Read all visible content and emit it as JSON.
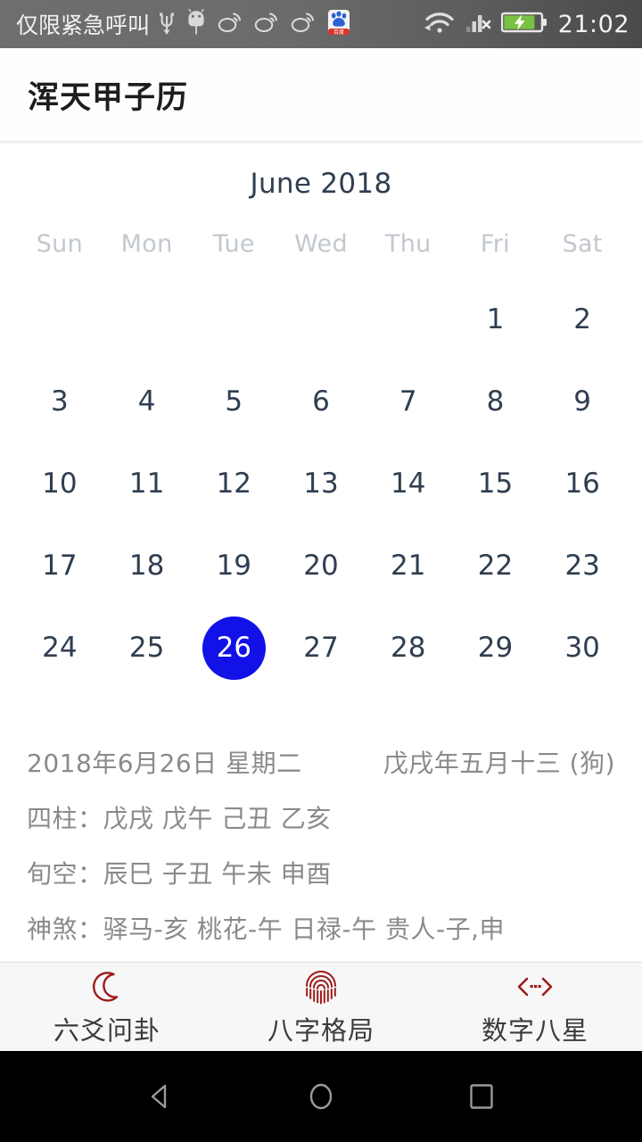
{
  "statusbar": {
    "carrier_text": "仅限紧急呼叫",
    "clock": "21:02",
    "left_icons": [
      "usb-icon",
      "android-robot-icon",
      "weibo-icon",
      "weibo-icon",
      "weibo-icon",
      "baidu-icon"
    ],
    "right_icons": [
      "wifi-icon",
      "cellular-no-sim-icon",
      "battery-charging-icon"
    ],
    "background_color": "#6a6a6a",
    "battery_color": "#7ac143"
  },
  "appbar": {
    "title": "浑天甲子历",
    "background_color": "#fefefe"
  },
  "calendar": {
    "month_label": "June 2018",
    "weekdays": [
      "Sun",
      "Mon",
      "Tue",
      "Wed",
      "Thu",
      "Fri",
      "Sat"
    ],
    "selected_day": "26",
    "selected_color": "#1111e8",
    "day_color": "#2f3e50",
    "weekday_color": "#c2c8ce",
    "weeks": [
      [
        "",
        "",
        "",
        "",
        "",
        "1",
        "2"
      ],
      [
        "3",
        "4",
        "5",
        "6",
        "7",
        "8",
        "9"
      ],
      [
        "10",
        "11",
        "12",
        "13",
        "14",
        "15",
        "16"
      ],
      [
        "17",
        "18",
        "19",
        "20",
        "21",
        "22",
        "23"
      ],
      [
        "24",
        "25",
        "26",
        "27",
        "28",
        "29",
        "30"
      ]
    ]
  },
  "info": {
    "solar_date": "2018年6月26日 星期二",
    "lunar_date": "戊戌年五月十三 (狗)",
    "pillars_line": "四柱：戊戌 戊午 己丑 乙亥",
    "xunkong_line": "旬空：辰巳 子丑 午未 申酉",
    "shensha_line": "神煞：驿马-亥 桃花-午 日禄-午 贵人-子,申",
    "text_color": "#8a8a8a"
  },
  "tabbar": {
    "accent_color": "#9e1b1b",
    "background_color": "#f7f7f7",
    "items": [
      {
        "label": "六爻问卦",
        "icon": "crescent-moon-icon"
      },
      {
        "label": "八字格局",
        "icon": "fingerprint-icon"
      },
      {
        "label": "数字八星",
        "icon": "code-brackets-icon"
      }
    ]
  },
  "navbar": {
    "buttons": [
      {
        "name": "back-button",
        "icon": "triangle-back-icon"
      },
      {
        "name": "home-button",
        "icon": "circle-home-icon"
      },
      {
        "name": "recents-button",
        "icon": "square-recents-icon"
      }
    ],
    "icon_color": "#9a9a9a",
    "background_color": "#000000"
  }
}
